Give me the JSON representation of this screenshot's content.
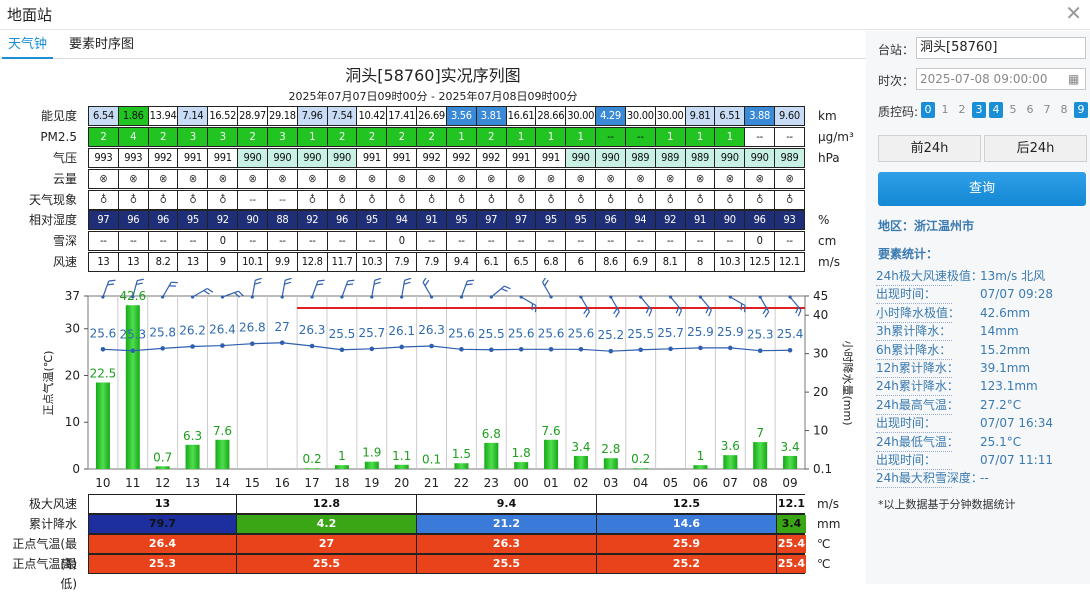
{
  "window": {
    "title": "地面站"
  },
  "tabs": [
    {
      "label": "天气钟"
    },
    {
      "label": "要素时序图"
    }
  ],
  "chart_title": "洞头[58760]实况序列图",
  "chart_subtitle": "2025年07月07日09时00分 - 2025年07月08日09时00分",
  "hours": [
    "10",
    "11",
    "12",
    "13",
    "14",
    "15",
    "16",
    "17",
    "18",
    "19",
    "20",
    "21",
    "22",
    "23",
    "00",
    "01",
    "02",
    "03",
    "04",
    "05",
    "06",
    "07",
    "08",
    "09"
  ],
  "table": {
    "rows": [
      {
        "label": "能见度",
        "unit": "km",
        "type": "vis",
        "values": [
          "6.54",
          "1.86",
          "13.94",
          "7.14",
          "16.52",
          "28.97",
          "29.18",
          "7.96",
          "7.54",
          "10.42",
          "17.41",
          "26.69",
          "3.56",
          "3.81",
          "16.61",
          "28.66",
          "30.00",
          "4.29",
          "30.00",
          "30.00",
          "9.81",
          "6.51",
          "3.88",
          "9.60"
        ]
      },
      {
        "label": "PM2.5",
        "unit": "μg/m³",
        "type": "pm",
        "values": [
          "2",
          "4",
          "2",
          "3",
          "3",
          "2",
          "3",
          "1",
          "2",
          "2",
          "2",
          "2",
          "1",
          "2",
          "1",
          "1",
          "1",
          "--",
          "--",
          "1",
          "1",
          "1",
          "--",
          "--"
        ]
      },
      {
        "label": "气压",
        "unit": "hPa",
        "type": "pres",
        "values": [
          "993",
          "993",
          "992",
          "991",
          "991",
          "990",
          "990",
          "990",
          "990",
          "991",
          "991",
          "992",
          "992",
          "992",
          "991",
          "991",
          "990",
          "990",
          "989",
          "989",
          "989",
          "990",
          "990",
          "989"
        ]
      },
      {
        "label": "云量",
        "unit": "",
        "type": "sym",
        "values": [
          "⊗",
          "⊗",
          "⊗",
          "⊗",
          "⊗",
          "⊗",
          "⊗",
          "⊗",
          "⊗",
          "⊗",
          "⊗",
          "⊗",
          "⊗",
          "⊗",
          "⊗",
          "⊗",
          "⊗",
          "⊗",
          "⊗",
          "⊗",
          "⊗",
          "⊗",
          "⊗",
          "⊗"
        ]
      },
      {
        "label": "天气现象",
        "unit": "",
        "type": "sym",
        "values": [
          "♁",
          "♁",
          "♁",
          "♁",
          "♁",
          "--",
          "--",
          "♁",
          "♁",
          "♁",
          "♁",
          "♁",
          "♁",
          "♁",
          "♁",
          "♁",
          "♁",
          "♁",
          "♁",
          "♁",
          "♁",
          "♁",
          "♁",
          "♁"
        ]
      },
      {
        "label": "相对湿度",
        "unit": "%",
        "type": "rh",
        "values": [
          "97",
          "96",
          "96",
          "95",
          "92",
          "90",
          "88",
          "92",
          "96",
          "95",
          "94",
          "91",
          "95",
          "97",
          "97",
          "95",
          "95",
          "96",
          "94",
          "92",
          "91",
          "90",
          "96",
          "93"
        ]
      },
      {
        "label": "雪深",
        "unit": "cm",
        "type": "plain",
        "values": [
          "--",
          "--",
          "--",
          "--",
          "0",
          "--",
          "--",
          "--",
          "--",
          "--",
          "0",
          "--",
          "--",
          "--",
          "--",
          "--",
          "--",
          "--",
          "--",
          "--",
          "--",
          "--",
          "0",
          "--"
        ]
      },
      {
        "label": "风速",
        "unit": "m/s",
        "type": "plain",
        "values": [
          "13",
          "13",
          "8.2",
          "13",
          "9",
          "10.1",
          "9.9",
          "12.8",
          "11.7",
          "10.3",
          "7.9",
          "7.9",
          "9.4",
          "6.1",
          "6.5",
          "6.8",
          "6",
          "8.6",
          "6.9",
          "8.1",
          "8",
          "10.3",
          "12.5",
          "12.1"
        ]
      }
    ]
  },
  "chart_data": {
    "type": "bar+line",
    "x": [
      "10",
      "11",
      "12",
      "13",
      "14",
      "15",
      "16",
      "17",
      "18",
      "19",
      "20",
      "21",
      "22",
      "23",
      "00",
      "01",
      "02",
      "03",
      "04",
      "05",
      "06",
      "07",
      "08",
      "09"
    ],
    "series": [
      {
        "name": "小时降水量(mm)",
        "axis": "right",
        "type": "bar",
        "values": [
          22.5,
          42.6,
          0.7,
          6.3,
          7.6,
          0,
          0,
          0.2,
          1,
          1.9,
          1.1,
          0.1,
          1.5,
          6.8,
          1.8,
          7.6,
          3.4,
          2.8,
          0.2,
          0,
          1,
          3.6,
          7,
          3.4
        ],
        "labels": [
          "22.5",
          "42.6",
          "0.7",
          "6.3",
          "7.6",
          "",
          "",
          "0.2",
          "1",
          "1.9",
          "1.1",
          "0.1",
          "1.5",
          "6.8",
          "1.8",
          "7.6",
          "3.4",
          "2.8",
          "0.2",
          "",
          "1",
          "3.6",
          "7",
          "3.4"
        ]
      },
      {
        "name": "正点气温(℃)",
        "axis": "left",
        "type": "line",
        "values": [
          25.6,
          25.3,
          25.8,
          26.2,
          26.4,
          26.8,
          27,
          26.3,
          25.5,
          25.7,
          26.1,
          26.3,
          25.6,
          25.5,
          25.6,
          25.6,
          25.6,
          25.2,
          25.5,
          25.7,
          25.9,
          25.9,
          25.3,
          25.4
        ]
      }
    ],
    "wind_dir_deg": [
      20,
      15,
      30,
      60,
      70,
      10,
      10,
      20,
      20,
      10,
      10,
      330,
      20,
      50,
      120,
      330,
      150,
      150,
      140,
      140,
      140,
      120,
      150,
      140
    ],
    "yleft": {
      "label": "正点气温(℃)",
      "ticks": [
        "0",
        "10",
        "20",
        "30",
        "37"
      ],
      "range": [
        0,
        37
      ]
    },
    "yright": {
      "label": "小时降水量(mm)",
      "ticks": [
        "0.1",
        "10",
        "20",
        "30",
        "40",
        "45"
      ],
      "range": [
        0,
        45
      ]
    },
    "red_line_span": [
      "17",
      "09"
    ],
    "colors": {
      "bar": "#2ec42e",
      "line": "#2f5fb0",
      "label": "#2f6bb0",
      "red": "#e02020"
    }
  },
  "bottom_table": {
    "rows": [
      {
        "label": "极大风速",
        "unit": "m/s",
        "segments": [
          {
            "value": "13",
            "color": "#ffffff",
            "text": "#111"
          },
          {
            "value": "12.8",
            "color": "#ffffff",
            "text": "#111"
          },
          {
            "value": "9.4",
            "color": "#ffffff",
            "text": "#111"
          },
          {
            "value": "12.5",
            "color": "#ffffff",
            "text": "#111"
          },
          {
            "value": "12.1",
            "color": "#ffffff",
            "text": "#111"
          }
        ]
      },
      {
        "label": "累计降水",
        "unit": "mm",
        "segments": [
          {
            "value": "79.7",
            "color": "#1d2f9e",
            "text": "#111"
          },
          {
            "value": "4.2",
            "color": "#3aa616",
            "text": "#fff"
          },
          {
            "value": "21.2",
            "color": "#3a7ad8",
            "text": "#fff"
          },
          {
            "value": "14.6",
            "color": "#3a7ad8",
            "text": "#fff"
          },
          {
            "value": "3.4",
            "color": "#3aa616",
            "text": "#111"
          }
        ]
      },
      {
        "label": "正点气温(最高)",
        "unit": "℃",
        "segments": [
          {
            "value": "26.4",
            "color": "#e8431a",
            "text": "#fff"
          },
          {
            "value": "27",
            "color": "#e8431a",
            "text": "#fff"
          },
          {
            "value": "26.3",
            "color": "#e8431a",
            "text": "#fff"
          },
          {
            "value": "25.9",
            "color": "#e8431a",
            "text": "#fff"
          },
          {
            "value": "25.4",
            "color": "#e8431a",
            "text": "#fff"
          }
        ]
      },
      {
        "label": "正点气温(最低)",
        "unit": "℃",
        "segments": [
          {
            "value": "25.3",
            "color": "#e8431a",
            "text": "#fff"
          },
          {
            "value": "25.5",
            "color": "#e8431a",
            "text": "#fff"
          },
          {
            "value": "25.5",
            "color": "#e8431a",
            "text": "#fff"
          },
          {
            "value": "25.2",
            "color": "#e8431a",
            "text": "#fff"
          },
          {
            "value": "25.4",
            "color": "#e8431a",
            "text": "#fff"
          }
        ]
      }
    ]
  },
  "right_panel": {
    "station_label": "台站：",
    "station_value": "洞头[58760]",
    "time_label": "时次：",
    "time_value": "2025-07-08 09:00:00",
    "qc_label": "质控码:",
    "qc_codes": [
      {
        "code": "0",
        "on": true
      },
      {
        "code": "1",
        "on": false
      },
      {
        "code": "2",
        "on": false
      },
      {
        "code": "3",
        "on": true
      },
      {
        "code": "4",
        "on": true
      },
      {
        "code": "5",
        "on": false
      },
      {
        "code": "6",
        "on": false
      },
      {
        "code": "7",
        "on": false
      },
      {
        "code": "8",
        "on": false
      },
      {
        "code": "9",
        "on": true
      }
    ],
    "prev_button": "前24h",
    "next_button": "后24h",
    "query_button": "查询",
    "region": "地区：浙江温州市",
    "stats_title": "要素统计：",
    "stats": [
      {
        "key": "24h极大风速极值：",
        "value": "13m/s 北风"
      },
      {
        "key": "出现时间：",
        "value": "07/07 09:28"
      },
      {
        "key": "小时降水极值：",
        "value": "42.6mm"
      },
      {
        "key": "3h累计降水：",
        "value": "14mm"
      },
      {
        "key": "6h累计降水：",
        "value": "15.2mm"
      },
      {
        "key": "12h累计降水：",
        "value": "39.1mm"
      },
      {
        "key": "24h累计降水：",
        "value": "123.1mm"
      },
      {
        "key": "24h最高气温：",
        "value": "27.2°C"
      },
      {
        "key": "出现时间：",
        "value": "07/07 16:34"
      },
      {
        "key": "24h最低气温：",
        "value": "25.1°C"
      },
      {
        "key": "出现时间：",
        "value": "07/07 11:11"
      },
      {
        "key": "24h最大积雪深度：",
        "value": "--"
      }
    ],
    "note": "*以上数据基于分钟数据统计"
  },
  "colors": {
    "accent": "#1a8fd8",
    "table_dark": "#1f2f77",
    "green": "#22c422",
    "pale_green": "#c8f0d8",
    "light_blue": "#c9dcf5",
    "blue": "#3a8ad8"
  }
}
